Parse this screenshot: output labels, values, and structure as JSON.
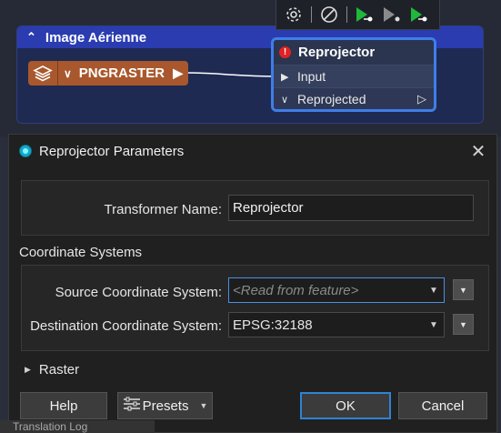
{
  "canvas": {
    "bookmark": {
      "title": "Image Aérienne"
    },
    "reader": {
      "name": "PNGRASTER"
    },
    "transformer": {
      "name": "Reprojector",
      "input_port": "Input",
      "output_port": "Reprojected"
    },
    "toolbar": {
      "icons": [
        "gear-icon",
        "disable-icon",
        "run-from-icon",
        "run-to-icon",
        "run-just-icon"
      ]
    }
  },
  "dialog": {
    "title": "Reprojector Parameters",
    "transformer_name_label": "Transformer Name:",
    "transformer_name_value": "Reprojector",
    "coordinate_systems_label": "Coordinate Systems",
    "source_label": "Source Coordinate System:",
    "source_placeholder": "<Read from feature>",
    "destination_label": "Destination Coordinate System:",
    "destination_value": "EPSG:32188",
    "raster_label": "Raster",
    "buttons": {
      "help": "Help",
      "presets": "Presets",
      "ok": "OK",
      "cancel": "Cancel"
    }
  },
  "background_tab": {
    "label": "Translation Log"
  },
  "colors": {
    "bookmark_header": "#2a3cb0",
    "reader": "#a8582c",
    "transformer_border": "#3f7ee8",
    "focus_border": "#4a90e2",
    "error": "#e02222",
    "run_green": "#1fb83a"
  }
}
